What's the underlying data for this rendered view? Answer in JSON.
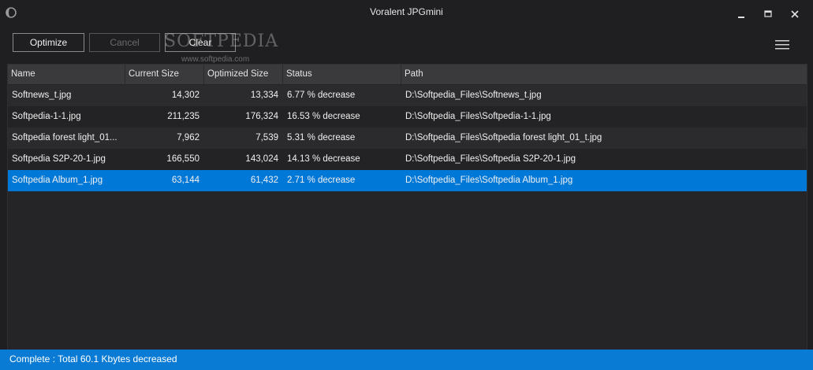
{
  "window": {
    "title": "Voralent JPGmini",
    "controls": {
      "minimize": "minimize-icon",
      "maximize": "maximize-icon",
      "close": "close-icon"
    }
  },
  "toolbar": {
    "optimize_label": "Optimize",
    "cancel_label": "Cancel",
    "clear_label": "Clear",
    "menu_icon": "hamburger-menu-icon"
  },
  "watermark": {
    "text": "SOFTPEDIA",
    "sub": "www.softpedia.com"
  },
  "table": {
    "columns": [
      "Name",
      "Current Size",
      "Optimized Size",
      "Status",
      "Path"
    ],
    "rows": [
      {
        "name": "Softnews_t.jpg",
        "current": "14,302",
        "optimized": "13,334",
        "status": "6.77 % decrease",
        "path": "D:\\Softpedia_Files\\Softnews_t.jpg"
      },
      {
        "name": "Softpedia-1-1.jpg",
        "current": "211,235",
        "optimized": "176,324",
        "status": "16.53 % decrease",
        "path": "D:\\Softpedia_Files\\Softpedia-1-1.jpg"
      },
      {
        "name": "Softpedia forest light_01...",
        "current": "7,962",
        "optimized": "7,539",
        "status": "5.31 % decrease",
        "path": "D:\\Softpedia_Files\\Softpedia forest light_01_t.jpg"
      },
      {
        "name": "Softpedia S2P-20-1.jpg",
        "current": "166,550",
        "optimized": "143,024",
        "status": "14.13 % decrease",
        "path": "D:\\Softpedia_Files\\Softpedia S2P-20-1.jpg"
      },
      {
        "name": "Softpedia Album_1.jpg",
        "current": "63,144",
        "optimized": "61,432",
        "status": "2.71 % decrease",
        "path": "D:\\Softpedia_Files\\Softpedia Album_1.jpg"
      }
    ],
    "selected_index": 4
  },
  "status": {
    "text": "Complete : Total 60.1 Kbytes decreased"
  },
  "colors": {
    "accent": "#0078d7",
    "statusbar": "#0a7bd5",
    "background": "#1f1f21"
  }
}
